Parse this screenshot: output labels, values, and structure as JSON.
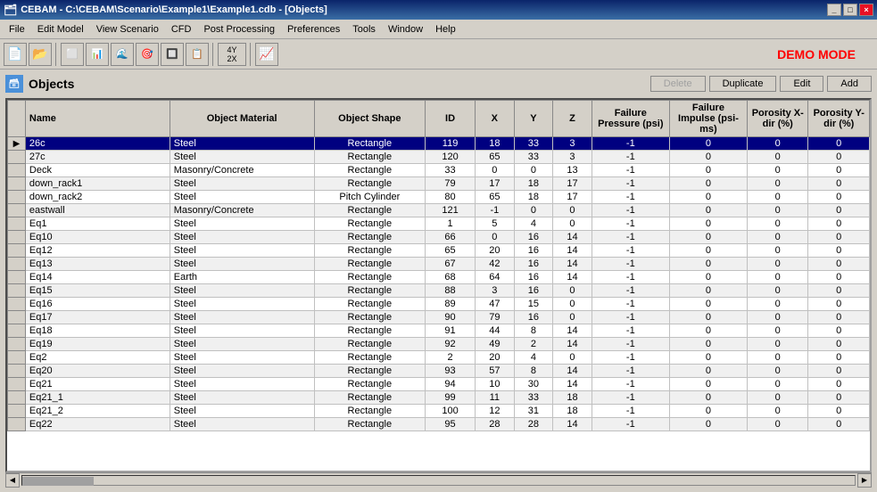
{
  "titleBar": {
    "title": "CEBAM - C:\\CEBAM\\Scenario\\Example1\\Example1.cdb - [Objects]",
    "controls": [
      "_",
      "□",
      "×"
    ]
  },
  "menuBar": {
    "items": [
      "File",
      "Edit Model",
      "View Scenario",
      "CFD",
      "Post Processing",
      "Preferences",
      "Tools",
      "Window",
      "Help"
    ]
  },
  "toolbar": {
    "demoMode": "DEMO MODE"
  },
  "panel": {
    "title": "Objects",
    "buttons": {
      "delete": "Delete",
      "duplicate": "Duplicate",
      "edit": "Edit",
      "add": "Add"
    }
  },
  "table": {
    "columns": [
      "Name",
      "Object Material",
      "Object Shape",
      "ID",
      "X",
      "Y",
      "Z",
      "Failure Pressure (psi)",
      "Failure Impulse (psi-ms)",
      "Porosity X-dir (%)",
      "Porosity Y-dir (%)"
    ],
    "rows": [
      {
        "selected": true,
        "name": "26c",
        "material": "Steel",
        "shape": "Rectangle",
        "id": 119,
        "x": 18,
        "y": 33,
        "z": 3,
        "fp": -1,
        "fi": 0,
        "px": 0,
        "py": 0
      },
      {
        "selected": false,
        "name": "27c",
        "material": "Steel",
        "shape": "Rectangle",
        "id": 120,
        "x": 65,
        "y": 33,
        "z": 3,
        "fp": -1,
        "fi": 0,
        "px": 0,
        "py": 0
      },
      {
        "selected": false,
        "name": "Deck",
        "material": "Masonry/Concrete",
        "shape": "Rectangle",
        "id": 33,
        "x": 0,
        "y": 0,
        "z": 13,
        "fp": -1,
        "fi": 0,
        "px": 0,
        "py": 0
      },
      {
        "selected": false,
        "name": "down_rack1",
        "material": "Steel",
        "shape": "Rectangle",
        "id": 79,
        "x": 17,
        "y": 18,
        "z": 17,
        "fp": -1,
        "fi": 0,
        "px": 0,
        "py": 0
      },
      {
        "selected": false,
        "name": "down_rack2",
        "material": "Steel",
        "shape": "Pitch Cylinder",
        "id": 80,
        "x": 65,
        "y": 18,
        "z": 17,
        "fp": -1,
        "fi": 0,
        "px": 0,
        "py": 0
      },
      {
        "selected": false,
        "name": "eastwall",
        "material": "Masonry/Concrete",
        "shape": "Rectangle",
        "id": 121,
        "x": -1,
        "y": 0,
        "z": 0,
        "fp": -1,
        "fi": 0,
        "px": 0,
        "py": 0
      },
      {
        "selected": false,
        "name": "Eq1",
        "material": "Steel",
        "shape": "Rectangle",
        "id": 1,
        "x": 5,
        "y": 4,
        "z": 0,
        "fp": -1,
        "fi": 0,
        "px": 0,
        "py": 0
      },
      {
        "selected": false,
        "name": "Eq10",
        "material": "Steel",
        "shape": "Rectangle",
        "id": 66,
        "x": 0,
        "y": 16,
        "z": 14,
        "fp": -1,
        "fi": 0,
        "px": 0,
        "py": 0
      },
      {
        "selected": false,
        "name": "Eq12",
        "material": "Steel",
        "shape": "Rectangle",
        "id": 65,
        "x": 20,
        "y": 16,
        "z": 14,
        "fp": -1,
        "fi": 0,
        "px": 0,
        "py": 0
      },
      {
        "selected": false,
        "name": "Eq13",
        "material": "Steel",
        "shape": "Rectangle",
        "id": 67,
        "x": 42,
        "y": 16,
        "z": 14,
        "fp": -1,
        "fi": 0,
        "px": 0,
        "py": 0
      },
      {
        "selected": false,
        "name": "Eq14",
        "material": "Earth",
        "shape": "Rectangle",
        "id": 68,
        "x": 64,
        "y": 16,
        "z": 14,
        "fp": -1,
        "fi": 0,
        "px": 0,
        "py": 0
      },
      {
        "selected": false,
        "name": "Eq15",
        "material": "Steel",
        "shape": "Rectangle",
        "id": 88,
        "x": 3,
        "y": 16,
        "z": 0,
        "fp": -1,
        "fi": 0,
        "px": 0,
        "py": 0
      },
      {
        "selected": false,
        "name": "Eq16",
        "material": "Steel",
        "shape": "Rectangle",
        "id": 89,
        "x": 47,
        "y": 15,
        "z": 0,
        "fp": -1,
        "fi": 0,
        "px": 0,
        "py": 0
      },
      {
        "selected": false,
        "name": "Eq17",
        "material": "Steel",
        "shape": "Rectangle",
        "id": 90,
        "x": 79,
        "y": 16,
        "z": 0,
        "fp": -1,
        "fi": 0,
        "px": 0,
        "py": 0
      },
      {
        "selected": false,
        "name": "Eq18",
        "material": "Steel",
        "shape": "Rectangle",
        "id": 91,
        "x": 44,
        "y": 8,
        "z": 14,
        "fp": -1,
        "fi": 0,
        "px": 0,
        "py": 0
      },
      {
        "selected": false,
        "name": "Eq19",
        "material": "Steel",
        "shape": "Rectangle",
        "id": 92,
        "x": 49,
        "y": 2,
        "z": 14,
        "fp": -1,
        "fi": 0,
        "px": 0,
        "py": 0
      },
      {
        "selected": false,
        "name": "Eq2",
        "material": "Steel",
        "shape": "Rectangle",
        "id": 2,
        "x": 20,
        "y": 4,
        "z": 0,
        "fp": -1,
        "fi": 0,
        "px": 0,
        "py": 0
      },
      {
        "selected": false,
        "name": "Eq20",
        "material": "Steel",
        "shape": "Rectangle",
        "id": 93,
        "x": 57,
        "y": 8,
        "z": 14,
        "fp": -1,
        "fi": 0,
        "px": 0,
        "py": 0
      },
      {
        "selected": false,
        "name": "Eq21",
        "material": "Steel",
        "shape": "Rectangle",
        "id": 94,
        "x": 10,
        "y": 30,
        "z": 14,
        "fp": -1,
        "fi": 0,
        "px": 0,
        "py": 0
      },
      {
        "selected": false,
        "name": "Eq21_1",
        "material": "Steel",
        "shape": "Rectangle",
        "id": 99,
        "x": 11,
        "y": 33,
        "z": 18,
        "fp": -1,
        "fi": 0,
        "px": 0,
        "py": 0
      },
      {
        "selected": false,
        "name": "Eq21_2",
        "material": "Steel",
        "shape": "Rectangle",
        "id": 100,
        "x": 12,
        "y": 31,
        "z": 18,
        "fp": -1,
        "fi": 0,
        "px": 0,
        "py": 0
      },
      {
        "selected": false,
        "name": "Eq22",
        "material": "Steel",
        "shape": "Rectangle",
        "id": 95,
        "x": 28,
        "y": 28,
        "z": 14,
        "fp": -1,
        "fi": 0,
        "px": 0,
        "py": 0
      }
    ]
  }
}
